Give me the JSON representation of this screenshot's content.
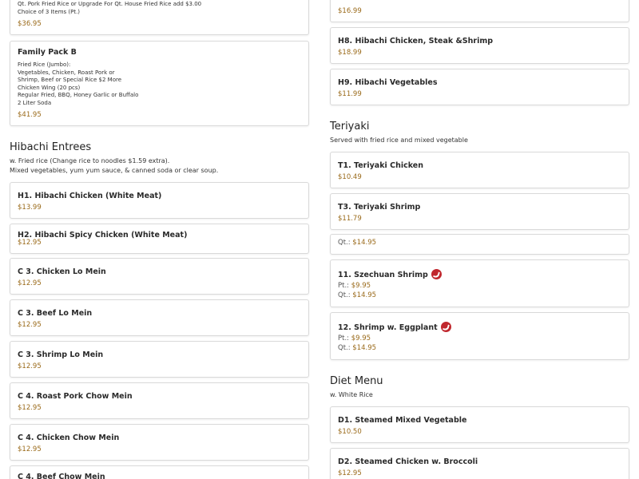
{
  "left": {
    "top_partial_card": {
      "desc_lines": [
        "Qt. Pork Fried Rice or Upgrade For Qt. House Fried Rice add $3.00",
        "Choice of 3 Items (Pt.)"
      ],
      "price": "$36.95"
    },
    "family_pack_b": {
      "name": "Family Pack B",
      "desc_lines": [
        "Fried Rice (Jumbo):",
        "Vegetables, Chicken, Roast Pork or",
        "Shrimp, Beef or Special Rice $2 More",
        "Chicken Wing (20 pcs)",
        "Regular Fried, BBQ, Honey Garlic or Buffalo",
        "2 Liter Soda"
      ],
      "price": "$41.95"
    },
    "hibachi_section": {
      "title": "Hibachi Entrees",
      "subtitle_lines": [
        "w. Fried rice (Change rice to noodles $1.59 extra).",
        "Mixed vegetables, yum yum sauce, & canned soda or clear soup."
      ]
    },
    "items": [
      {
        "name": "H1. Hibachi Chicken (White Meat)",
        "price": "$13.99"
      },
      {
        "name": "H2. Hibachi Spicy Chicken (White Meat)",
        "price": "$12.95"
      },
      {
        "name": "C 3. Chicken Lo Mein",
        "price": "$12.95"
      },
      {
        "name": "C 3. Beef Lo Mein",
        "price": "$12.95"
      },
      {
        "name": "C 3. Shrimp Lo Mein",
        "price": "$12.95"
      },
      {
        "name": "C 4. Roast Pork Chow Mein",
        "price": "$12.95"
      },
      {
        "name": "C 4. Chicken Chow Mein",
        "price": "$12.95"
      },
      {
        "name": "C 4. Beef Chow Mein",
        "price": ""
      }
    ]
  },
  "right": {
    "top_partial_price": "$16.99",
    "items_top": [
      {
        "name": "H8. Hibachi Chicken, Steak &Shrimp",
        "price": "$18.99"
      },
      {
        "name": "H9. Hibachi Vegetables",
        "price": "$11.99"
      }
    ],
    "teriyaki_section": {
      "title": "Teriyaki",
      "subtitle": "Served with fried rice and mixed vegetable"
    },
    "teriyaki_items": [
      {
        "name": "T1. Teriyaki Chicken",
        "price": "$10.49"
      },
      {
        "name": "T3. Teriyaki Shrimp",
        "price": "$11.79"
      }
    ],
    "overlap_card": {
      "qt_label": "Qt.:",
      "qt_price": "$14.95"
    },
    "spicy_items": [
      {
        "name": "11. Szechuan Shrimp",
        "pt_label": "Pt.:",
        "pt_price": "$9.95",
        "qt_label": "Qt.:",
        "qt_price": "$14.95",
        "icon": "hot-pepper-icon"
      },
      {
        "name": "12. Shrimp w. Eggplant",
        "pt_label": "Pt.:",
        "pt_price": "$9.95",
        "qt_label": "Qt.:",
        "qt_price": "$14.95",
        "icon": "hot-pepper-icon"
      }
    ],
    "diet_section": {
      "title": "Diet Menu",
      "subtitle": "w. White Rice"
    },
    "diet_items": [
      {
        "name": "D1. Steamed Mixed Vegetable",
        "price": "$10.50"
      },
      {
        "name": "D2. Steamed Chicken w. Broccoli",
        "price": "$12.95"
      }
    ]
  },
  "colors": {
    "price": "#9a6a1a",
    "spicy": "#c0272d",
    "border": "#d9d9d9"
  }
}
